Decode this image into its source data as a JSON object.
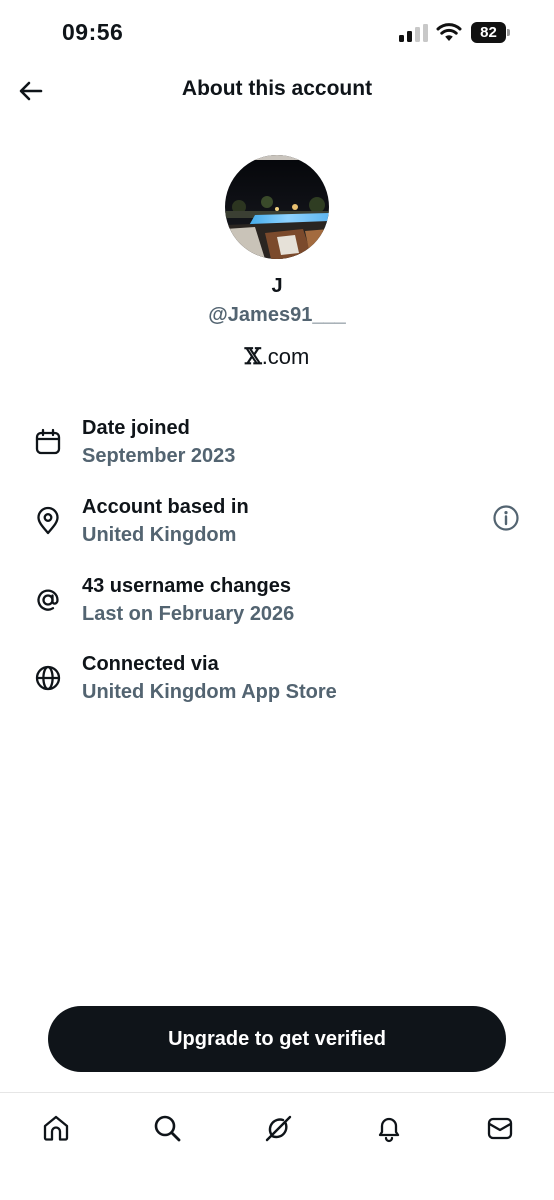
{
  "status_bar": {
    "time": "09:56",
    "battery": "82"
  },
  "header": {
    "title": "About this account"
  },
  "profile": {
    "display_name": "J",
    "handle": "@James91___",
    "site_logo": "𝕏",
    "site_suffix": ".com"
  },
  "info_rows": [
    {
      "icon": "calendar-icon",
      "title": "Date joined",
      "subtitle": "September 2023"
    },
    {
      "icon": "location-pin-icon",
      "title": "Account based in",
      "subtitle": "United Kingdom"
    },
    {
      "icon": "at-sign-icon",
      "title": "43 username changes",
      "subtitle": "Last on February 2026"
    },
    {
      "icon": "globe-icon",
      "title": "Connected via",
      "subtitle": "United Kingdom App Store"
    }
  ],
  "cta": {
    "label": "Upgrade to get verified"
  },
  "bottom_nav": [
    {
      "icon": "home-icon"
    },
    {
      "icon": "search-icon"
    },
    {
      "icon": "grok-icon"
    },
    {
      "icon": "bell-icon"
    },
    {
      "icon": "mail-icon"
    }
  ],
  "colors": {
    "primary_text": "#0f1419",
    "secondary_text": "#536471",
    "button_bg": "#0f1419",
    "background": "#ffffff"
  }
}
